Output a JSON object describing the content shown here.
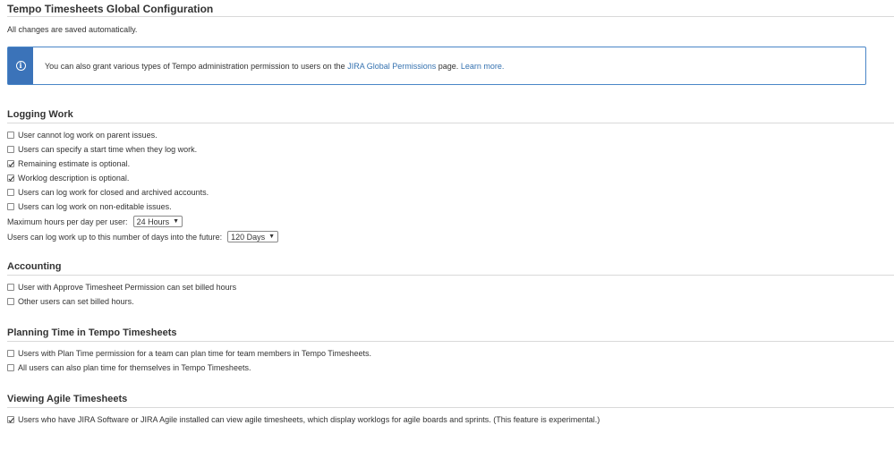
{
  "header": {
    "title": "Tempo Timesheets Global Configuration",
    "autosave_note": "All changes are saved automatically."
  },
  "info_box": {
    "text_before": "You can also grant various types of Tempo administration permission to users on the",
    "link_permissions": "JIRA Global Permissions",
    "text_after": "page.",
    "link_learn_more": "Learn more."
  },
  "logging_work": {
    "title": "Logging Work",
    "options": [
      {
        "label": "User cannot log work on parent issues.",
        "checked": false
      },
      {
        "label": "Users can specify a start time when they log work.",
        "checked": false
      },
      {
        "label": "Remaining estimate is optional.",
        "checked": true
      },
      {
        "label": "Worklog description is optional.",
        "checked": true
      },
      {
        "label": "Users can log work for closed and archived accounts.",
        "checked": false
      },
      {
        "label": "Users can log work on non-editable issues.",
        "checked": false
      }
    ],
    "max_hours_label": "Maximum hours per day per user:",
    "max_hours_value": "24 Hours",
    "future_days_label": "Users can log work up to this number of days into the future:",
    "future_days_value": "120 Days"
  },
  "accounting": {
    "title": "Accounting",
    "options": [
      {
        "label": "User with Approve Timesheet Permission can set billed hours",
        "checked": false
      },
      {
        "label": "Other users can set billed hours.",
        "checked": false
      }
    ]
  },
  "planning": {
    "title": "Planning Time in Tempo Timesheets",
    "options": [
      {
        "label": "Users with Plan Time permission for a team can plan time for team members in Tempo Timesheets.",
        "checked": false
      },
      {
        "label": "All users can also plan time for themselves in Tempo Timesheets.",
        "checked": false
      }
    ]
  },
  "agile": {
    "title": "Viewing Agile Timesheets",
    "options": [
      {
        "label": "Users who have JIRA Software or JIRA Agile installed can view agile timesheets, which display worklogs for agile boards and sprints. (This feature is experimental.)",
        "checked": true
      }
    ]
  },
  "icons": {
    "info": "info-icon",
    "dropdown": "caret-down-icon",
    "dropdown_glyph": "▼"
  }
}
